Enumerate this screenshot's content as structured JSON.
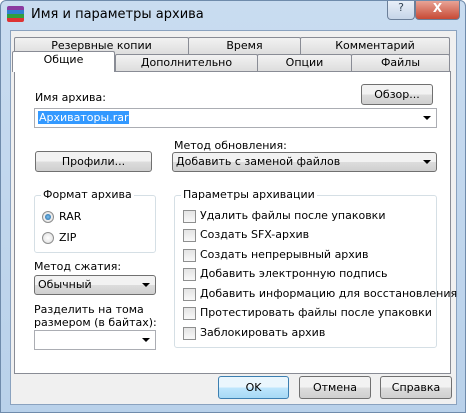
{
  "window": {
    "title": "Имя и параметры архива",
    "help_label": "?",
    "close_label": "X"
  },
  "tabs_row1": [
    "Резервные копии",
    "Время",
    "Комментарий"
  ],
  "tabs_row2": [
    "Общие",
    "Дополнительно",
    "Опции",
    "Файлы"
  ],
  "general": {
    "archive_name_label": "Имя архива:",
    "browse_label": "Обзор...",
    "archive_name_value": "Архиваторы.rar",
    "update_method_label": "Метод обновления:",
    "profiles_label": "Профили...",
    "update_method_value": "Добавить с заменой файлов",
    "format_group": "Формат архива",
    "format_options": [
      {
        "label": "RAR",
        "checked": true
      },
      {
        "label": "ZIP",
        "checked": false
      }
    ],
    "compression_label": "Метод сжатия:",
    "compression_value": "Обычный",
    "split_label_1": "Разделить на тома",
    "split_label_2": "размером (в байтах):",
    "split_value": "",
    "options_group": "Параметры архивации",
    "options": [
      {
        "label": "Удалить файлы после упаковки",
        "checked": false
      },
      {
        "label": "Создать SFX-архив",
        "checked": false
      },
      {
        "label": "Создать непрерывный архив",
        "checked": false
      },
      {
        "label": "Добавить электронную подпись",
        "checked": false
      },
      {
        "label": "Добавить информацию для восстановления",
        "checked": false
      },
      {
        "label": "Протестировать файлы после упаковки",
        "checked": false
      },
      {
        "label": "Заблокировать архив",
        "checked": false
      }
    ]
  },
  "footer": {
    "ok": "OK",
    "cancel": "Отмена",
    "help": "Справка"
  }
}
